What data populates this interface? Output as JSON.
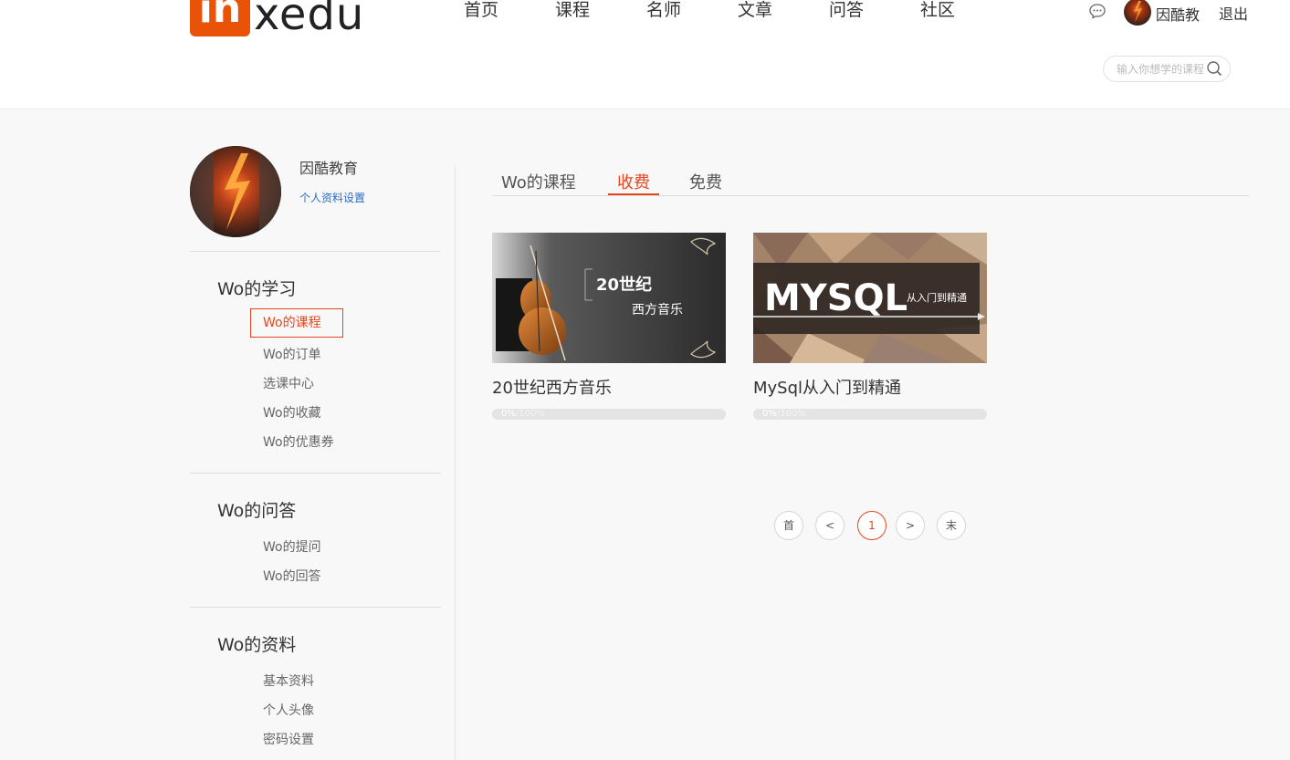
{
  "header": {
    "logo_mark": "in",
    "logo_text": "xedu",
    "nav": [
      "首页",
      "课程",
      "名师",
      "文章",
      "问答",
      "社区"
    ],
    "user_name": "因酷教",
    "logout": "退出",
    "search_placeholder": "输入你想学的课程"
  },
  "sidebar": {
    "profile_name": "因酷教育",
    "profile_settings": "个人资料设置",
    "sections": [
      {
        "title": "Wo的学习",
        "items": [
          "Wo的课程",
          "Wo的订单",
          "选课中心",
          "Wo的收藏",
          "Wo的优惠券"
        ]
      },
      {
        "title": "Wo的问答",
        "items": [
          "Wo的提问",
          "Wo的回答"
        ]
      },
      {
        "title": "Wo的资料",
        "items": [
          "基本资料",
          "个人头像",
          "密码设置"
        ]
      }
    ],
    "active_item": "Wo的课程"
  },
  "main": {
    "tabs": [
      "Wo的课程",
      "收费",
      "免费"
    ],
    "active_tab": "收费",
    "courses": [
      {
        "title": "20世纪西方音乐",
        "image_text_1": "20世纪",
        "image_text_2": "西方音乐",
        "progress_text": "0%",
        "progress_total": "/100%",
        "progress": 0
      },
      {
        "title": "MySql从入门到精通",
        "image_text_1": "MYSQL",
        "image_text_2": "从入门到精通",
        "progress_text": "0%",
        "progress_total": "/100%",
        "progress": 0
      }
    ],
    "pager": [
      "首",
      "<",
      "1",
      ">",
      "末"
    ],
    "current_page": "1"
  },
  "colors": {
    "accent": "#e8451e",
    "logo_orange": "#e85308",
    "link_blue": "#2b6cc4"
  }
}
